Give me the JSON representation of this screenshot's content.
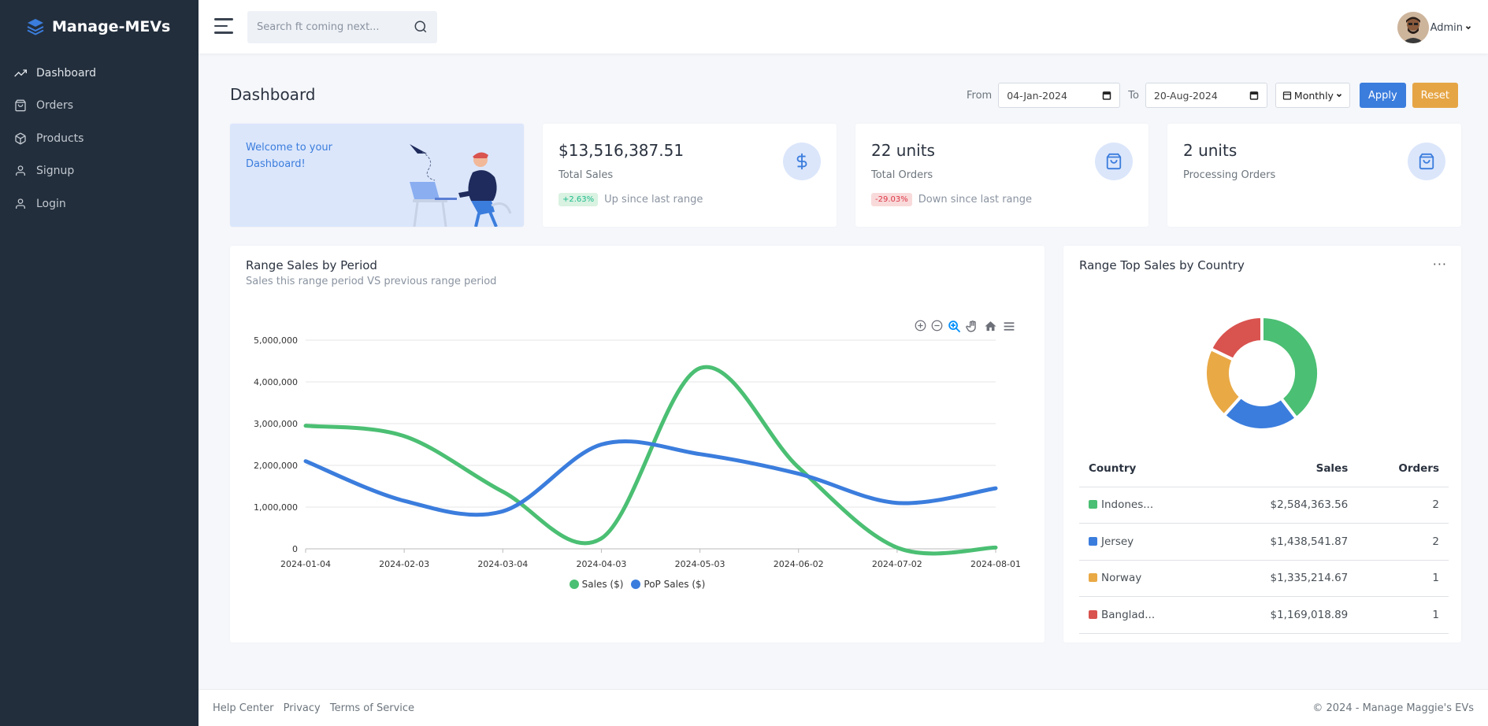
{
  "brand": {
    "name": "Manage-MEVs"
  },
  "sidebar": {
    "items": [
      {
        "label": "Dashboard",
        "icon": "trending-up-icon"
      },
      {
        "label": "Orders",
        "icon": "shopping-bag-icon"
      },
      {
        "label": "Products",
        "icon": "package-icon"
      },
      {
        "label": "Signup",
        "icon": "user-icon"
      },
      {
        "label": "Login",
        "icon": "user-icon"
      }
    ]
  },
  "topbar": {
    "search_placeholder": "Search ft coming next...",
    "user_name": "Admin"
  },
  "page": {
    "title": "Dashboard",
    "from_label": "From",
    "from_date": "04-Jan-2024",
    "to_label": "To",
    "to_date": "20-Aug-2024",
    "period": "Monthly",
    "apply_label": "Apply",
    "reset_label": "Reset"
  },
  "welcome": {
    "text": "Welcome to your Dashboard!"
  },
  "stats": [
    {
      "value": "$13,516,387.51",
      "label": "Total Sales",
      "badge": "+2.63%",
      "trend": "Up since last range",
      "direction": "up",
      "icon": "dollar-icon"
    },
    {
      "value": "22 units",
      "label": "Total Orders",
      "badge": "-29.03%",
      "trend": "Down since last range",
      "direction": "down",
      "icon": "shopping-bag-icon"
    },
    {
      "value": "2 units",
      "label": "Processing Orders",
      "icon": "shopping-bag-icon"
    }
  ],
  "sales_card": {
    "title": "Range Sales by Period",
    "subtitle": "Sales this range period VS previous range period"
  },
  "country_card": {
    "title": "Range Top Sales by Country",
    "columns": [
      "Country",
      "Sales",
      "Orders"
    ],
    "rows": [
      {
        "country": "Indones...",
        "sales": "$2,584,363.56",
        "orders": "2",
        "color": "#4bbf73"
      },
      {
        "country": "Jersey",
        "sales": "$1,438,541.87",
        "orders": "2",
        "color": "#3b7ddd"
      },
      {
        "country": "Norway",
        "sales": "$1,335,214.67",
        "orders": "1",
        "color": "#e9a945"
      },
      {
        "country": "Banglad...",
        "sales": "$1,169,018.89",
        "orders": "1",
        "color": "#d9534f"
      }
    ]
  },
  "footer": {
    "links": [
      "Help Center",
      "Privacy",
      "Terms of Service"
    ],
    "copyright": "© 2024 - Manage Maggie's EVs"
  },
  "chart_data": [
    {
      "type": "line",
      "x": [
        "2024-01-04",
        "2024-02-03",
        "2024-03-04",
        "2024-04-03",
        "2024-05-03",
        "2024-06-02",
        "2024-07-02",
        "2024-08-01"
      ],
      "ylim": [
        0,
        5000000
      ],
      "yticks": [
        "0",
        "1,000,000",
        "2,000,000",
        "3,000,000",
        "4,000,000",
        "5,000,000"
      ],
      "grid": true,
      "legend": "bottom-center",
      "series": [
        {
          "name": "Sales ($)",
          "color": "#4bbf73",
          "values": [
            2950000,
            2700000,
            1370000,
            250000,
            4330000,
            1950000,
            30000,
            30000
          ]
        },
        {
          "name": "PoP Sales ($)",
          "color": "#3b7ddd",
          "values": [
            2100000,
            1150000,
            900000,
            2500000,
            2270000,
            1800000,
            1100000,
            1450000
          ]
        }
      ]
    },
    {
      "type": "pie",
      "variant": "donut",
      "categories": [
        "Indonesia",
        "Jersey",
        "Norway",
        "Bangladesh"
      ],
      "values": [
        2584363.56,
        1438541.87,
        1335214.67,
        1169018.89
      ],
      "colors": [
        "#4bbf73",
        "#3b7ddd",
        "#e9a945",
        "#d9534f"
      ]
    }
  ]
}
